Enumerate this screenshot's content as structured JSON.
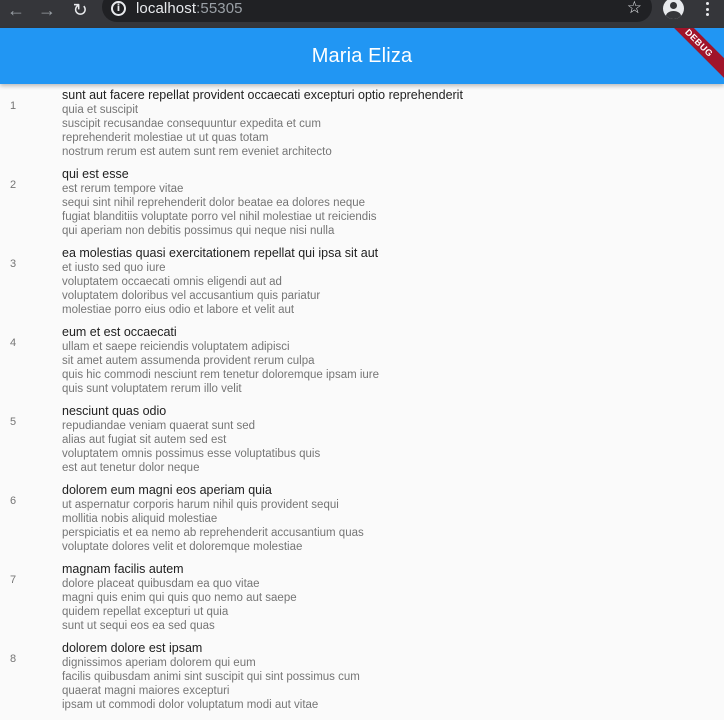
{
  "browser": {
    "url_host": "localhost",
    "url_port": ":55305"
  },
  "appbar": {
    "title": "Maria Eliza",
    "debug_label": "DEBUG"
  },
  "items": [
    {
      "id": "1",
      "title": "sunt aut facere repellat provident occaecati excepturi optio reprehenderit",
      "body": [
        "quia et suscipit",
        "suscipit recusandae consequuntur expedita et cum",
        "reprehenderit molestiae ut ut quas totam",
        "nostrum rerum est autem sunt rem eveniet architecto"
      ]
    },
    {
      "id": "2",
      "title": "qui est esse",
      "body": [
        "est rerum tempore vitae",
        "sequi sint nihil reprehenderit dolor beatae ea dolores neque",
        "fugiat blanditiis voluptate porro vel nihil molestiae ut reiciendis",
        "qui aperiam non debitis possimus qui neque nisi nulla"
      ]
    },
    {
      "id": "3",
      "title": "ea molestias quasi exercitationem repellat qui ipsa sit aut",
      "body": [
        "et iusto sed quo iure",
        "voluptatem occaecati omnis eligendi aut ad",
        "voluptatem doloribus vel accusantium quis pariatur",
        "molestiae porro eius odio et labore et velit aut"
      ]
    },
    {
      "id": "4",
      "title": "eum et est occaecati",
      "body": [
        "ullam et saepe reiciendis voluptatem adipisci",
        "sit amet autem assumenda provident rerum culpa",
        "quis hic commodi nesciunt rem tenetur doloremque ipsam iure",
        "quis sunt voluptatem rerum illo velit"
      ]
    },
    {
      "id": "5",
      "title": "nesciunt quas odio",
      "body": [
        "repudiandae veniam quaerat sunt sed",
        "alias aut fugiat sit autem sed est",
        "voluptatem omnis possimus esse voluptatibus quis",
        "est aut tenetur dolor neque"
      ]
    },
    {
      "id": "6",
      "title": "dolorem eum magni eos aperiam quia",
      "body": [
        "ut aspernatur corporis harum nihil quis provident sequi",
        "mollitia nobis aliquid molestiae",
        "perspiciatis et ea nemo ab reprehenderit accusantium quas",
        "voluptate dolores velit et doloremque molestiae"
      ]
    },
    {
      "id": "7",
      "title": "magnam facilis autem",
      "body": [
        "dolore placeat quibusdam ea quo vitae",
        "magni quis enim qui quis quo nemo aut saepe",
        "quidem repellat excepturi ut quia",
        "sunt ut sequi eos ea sed quas"
      ]
    },
    {
      "id": "8",
      "title": "dolorem dolore est ipsam",
      "body": [
        "dignissimos aperiam dolorem qui eum",
        "facilis quibusdam animi sint suscipit qui sint possimus cum",
        "quaerat magni maiores excepturi",
        "ipsam ut commodi dolor voluptatum modi aut vitae"
      ]
    }
  ]
}
